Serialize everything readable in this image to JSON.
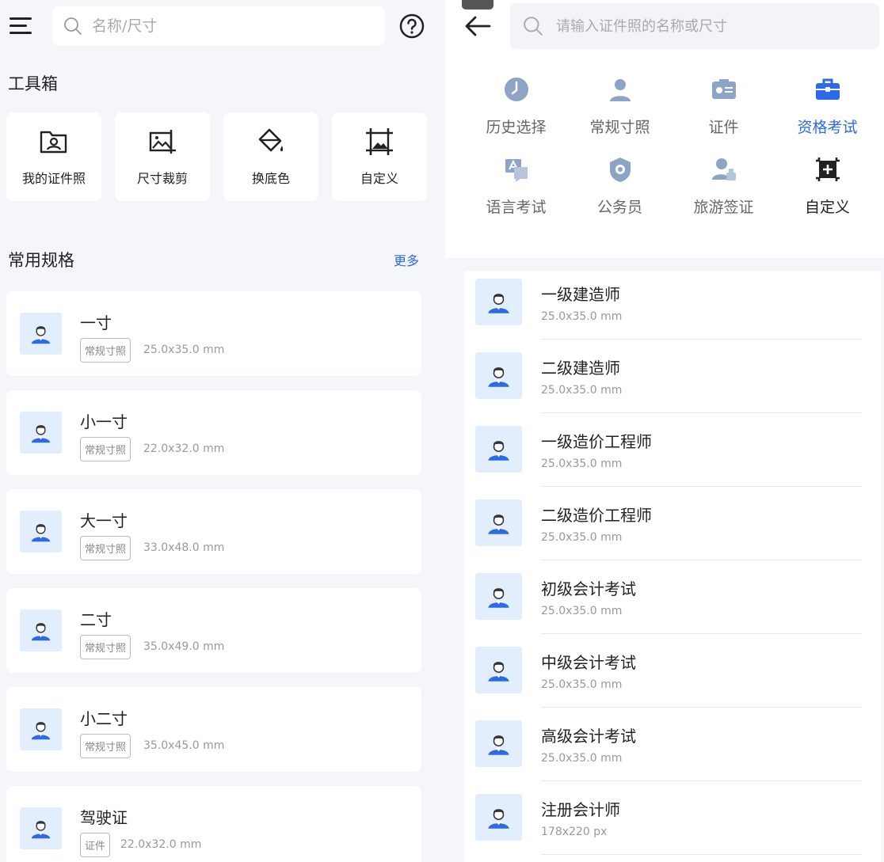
{
  "left": {
    "search_placeholder": "名称/尺寸",
    "toolbox_title": "工具箱",
    "tools": [
      {
        "label": "我的证件照",
        "icon": "folder-user-icon"
      },
      {
        "label": "尺寸裁剪",
        "icon": "image-crop-icon"
      },
      {
        "label": "换底色",
        "icon": "paint-bucket-icon"
      },
      {
        "label": "自定义",
        "icon": "custom-frame-icon"
      }
    ],
    "common_title": "常用规格",
    "more_label": "更多",
    "specs": [
      {
        "name": "一寸",
        "tag": "常规寸照",
        "size": "25.0x35.0 mm"
      },
      {
        "name": "小一寸",
        "tag": "常规寸照",
        "size": "22.0x32.0 mm"
      },
      {
        "name": "大一寸",
        "tag": "常规寸照",
        "size": "33.0x48.0 mm"
      },
      {
        "name": "二寸",
        "tag": "常规寸照",
        "size": "35.0x49.0 mm"
      },
      {
        "name": "小二寸",
        "tag": "常规寸照",
        "size": "35.0x45.0 mm"
      },
      {
        "name": "驾驶证",
        "tag": "证件",
        "size": "22.0x32.0 mm"
      }
    ]
  },
  "right": {
    "search_placeholder": "请输入证件照的名称或尺寸",
    "categories": [
      {
        "label": "历史选择",
        "icon": "clock-icon"
      },
      {
        "label": "常规寸照",
        "icon": "person-icon"
      },
      {
        "label": "证件",
        "icon": "id-card-icon"
      },
      {
        "label": "资格考试",
        "icon": "briefcase-icon"
      },
      {
        "label": "语言考试",
        "icon": "language-icon"
      },
      {
        "label": "公务员",
        "icon": "badge-icon"
      },
      {
        "label": "旅游签证",
        "icon": "visa-stamp-icon"
      },
      {
        "label": "自定义",
        "icon": "custom-add-icon"
      }
    ],
    "active_category": "资格考试",
    "items": [
      {
        "name": "一级建造师",
        "size": "25.0x35.0 mm"
      },
      {
        "name": "二级建造师",
        "size": "25.0x35.0 mm"
      },
      {
        "name": "一级造价工程师",
        "size": "25.0x35.0 mm"
      },
      {
        "name": "二级造价工程师",
        "size": "25.0x35.0 mm"
      },
      {
        "name": "初级会计考试",
        "size": "25.0x35.0 mm"
      },
      {
        "name": "中级会计考试",
        "size": "25.0x35.0 mm"
      },
      {
        "name": "高级会计考试",
        "size": "25.0x35.0 mm"
      },
      {
        "name": "注册会计师",
        "size": "178x220 px"
      }
    ]
  },
  "colors": {
    "accent": "#2d6ae8",
    "avatar_bg": "#e3eefc",
    "avatar_shirt": "#2d6ae8"
  }
}
